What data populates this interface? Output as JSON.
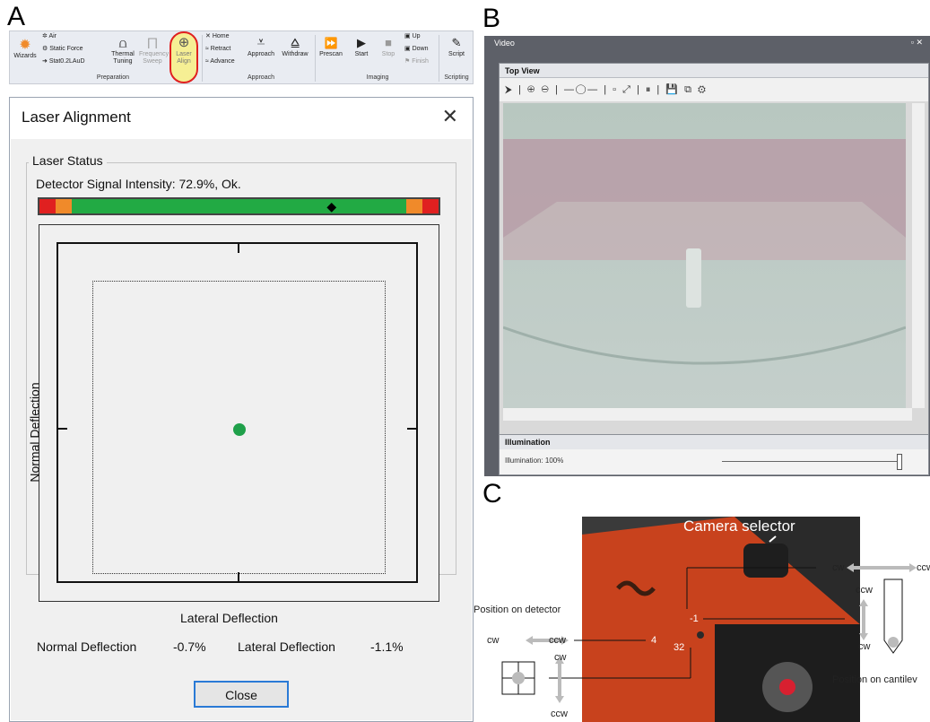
{
  "panels": {
    "a": "A",
    "b": "B",
    "c": "C"
  },
  "ribbon": {
    "wizards": "Wizards",
    "air": "Air",
    "static_force": "Static Force",
    "stat": "Stat0.2LAuD",
    "thermal": "Thermal Tuning",
    "frequency": "Frequency Sweep",
    "laser_align": "Laser Align",
    "home": "Home",
    "retract": "Retract",
    "advance": "Advance",
    "approach": "Approach",
    "withdraw": "Withdraw",
    "prescan": "Prescan",
    "start": "Start",
    "stop": "Stop",
    "up": "Up",
    "down": "Down",
    "finish": "Finish",
    "script": "Script",
    "groups": [
      "Preparation",
      "Approach",
      "Imaging",
      "Scripting"
    ]
  },
  "dialog": {
    "title": "Laser Alignment",
    "close_x": "✕",
    "group_title": "Laser Status",
    "signal_label": "Detector Signal Intensity: 72.9%, Ok.",
    "signal_fraction": 0.729,
    "x_axis_label": "Lateral Deflection",
    "y_axis_label": "Normal Deflection",
    "normal_label": "Normal Deflection",
    "normal_value": "-0.7%",
    "lateral_label": "Lateral Deflection",
    "lateral_value": "-1.1%",
    "close_button": "Close",
    "colors": {
      "green": "#22aa44",
      "orange": "#f08a2a",
      "red": "#e02020"
    }
  },
  "video": {
    "title": "Video",
    "pin": "▫ ✕",
    "top_view": "Top View",
    "toolbar": "⮞ | ⊕ ⊖ | —◯— | ▫ ⤢ | ⏸ | 💾 ⧉ ⚙",
    "illumination_header": "Illumination",
    "illumination_text": "Illumination: 100%"
  },
  "panel_c": {
    "camera_selector": "Camera selector",
    "position_on_detector": "Position on detector",
    "position_on_cantilever": "Position on cantilev",
    "cw": "cw",
    "ccw": "ccw",
    "nums": {
      "n1": "-1",
      "n2": "4",
      "n3": "32"
    }
  }
}
